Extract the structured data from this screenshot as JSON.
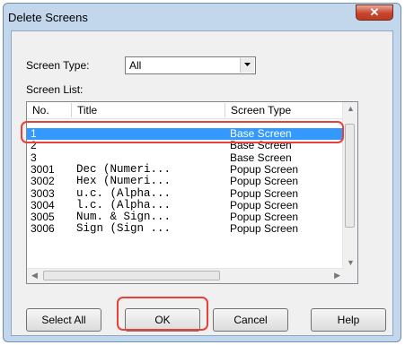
{
  "window": {
    "title": "Delete Screens",
    "close_icon": "close-icon"
  },
  "screen_type": {
    "label": "Screen Type:",
    "value": "All"
  },
  "screen_list": {
    "label": "Screen List:",
    "columns": [
      "No.",
      "Title",
      "Screen Type"
    ],
    "rows": [
      {
        "no": "1",
        "title": "",
        "type": "Base Screen",
        "selected": true
      },
      {
        "no": "2",
        "title": "",
        "type": "Base Screen"
      },
      {
        "no": "3",
        "title": "",
        "type": "Base Screen"
      },
      {
        "no": "3001",
        "title": "Dec (Numeri...",
        "type": "Popup Screen"
      },
      {
        "no": "3002",
        "title": "Hex (Numeri...",
        "type": "Popup Screen"
      },
      {
        "no": "3003",
        "title": "u.c. (Alpha...",
        "type": "Popup Screen"
      },
      {
        "no": "3004",
        "title": "l.c. (Alpha...",
        "type": "Popup Screen"
      },
      {
        "no": "3005",
        "title": "Num. & Sign...",
        "type": "Popup Screen"
      },
      {
        "no": "3006",
        "title": "Sign (Sign ...",
        "type": "Popup Screen"
      }
    ]
  },
  "buttons": {
    "select_all": "Select All",
    "ok": "OK",
    "cancel": "Cancel",
    "help": "Help"
  },
  "colors": {
    "selection": "#3399ff",
    "highlight": "#e8403a"
  }
}
